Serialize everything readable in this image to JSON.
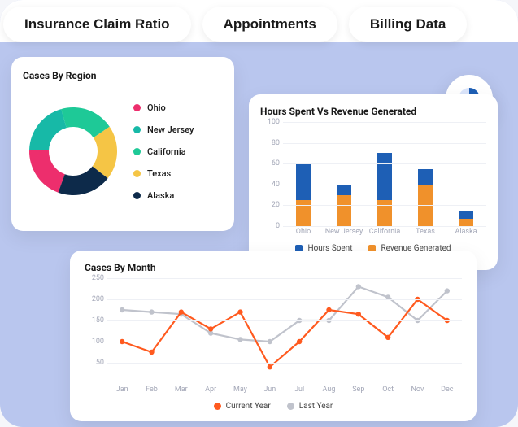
{
  "tabs": {
    "insurance": "Insurance Claim Ratio",
    "appointments": "Appointments",
    "billing": "Billing Data"
  },
  "region": {
    "title": "Cases By Region",
    "legend": {
      "ohio": "Ohio",
      "new_jersey": "New Jersey",
      "california": "California",
      "texas": "Texas",
      "alaska": "Alaska"
    }
  },
  "bar": {
    "title": "Hours Spent Vs Revenue Generated",
    "legend": {
      "hours": "Hours Spent",
      "revenue": "Revenue Generated"
    }
  },
  "line": {
    "title": "Cases By Month",
    "legend": {
      "current": "Current Year",
      "last": "Last Year"
    }
  },
  "colors": {
    "pink": "#ed2e6d",
    "teal": "#17b9a7",
    "green": "#1ec997",
    "yellow": "#f5c545",
    "navy": "#0d2a4a",
    "blue": "#1e5fb5",
    "orange": "#f0912b",
    "orange_line": "#ff5a1f",
    "grey_line": "#c0c3cc"
  },
  "chart_data": [
    {
      "id": "cases_by_region",
      "type": "pie",
      "title": "Cases By Region",
      "categories": [
        "Ohio",
        "New Jersey",
        "California",
        "Texas",
        "Alaska"
      ],
      "values": [
        20,
        20,
        20,
        20,
        20
      ],
      "colors": [
        "#ed2e6d",
        "#17b9a7",
        "#1ec997",
        "#f5c545",
        "#0d2a4a"
      ]
    },
    {
      "id": "hours_vs_revenue",
      "type": "bar",
      "title": "Hours Spent Vs Revenue Generated",
      "categories": [
        "Ohio",
        "New Jersey",
        "California",
        "Texas",
        "Alaska"
      ],
      "series": [
        {
          "name": "Hours Spent",
          "values": [
            35,
            10,
            45,
            15,
            8
          ],
          "color": "#1e5fb5"
        },
        {
          "name": "Revenue Generated",
          "values": [
            25,
            30,
            25,
            40,
            7
          ],
          "color": "#f0912b"
        }
      ],
      "ylim": [
        0,
        100
      ],
      "yticks": [
        0,
        20,
        40,
        60,
        80,
        100
      ],
      "ylabel": "",
      "xlabel": ""
    },
    {
      "id": "cases_by_month",
      "type": "line",
      "title": "Cases By Month",
      "categories": [
        "Jan",
        "Feb",
        "Mar",
        "Apr",
        "May",
        "Jun",
        "Jul",
        "Aug",
        "Sep",
        "Oct",
        "Nov",
        "Dec"
      ],
      "series": [
        {
          "name": "Current Year",
          "values": [
            100,
            75,
            170,
            130,
            170,
            40,
            100,
            175,
            165,
            110,
            200,
            150
          ],
          "color": "#ff5a1f"
        },
        {
          "name": "Last Year",
          "values": [
            175,
            170,
            165,
            120,
            105,
            100,
            150,
            150,
            230,
            205,
            150,
            220
          ],
          "color": "#c0c3cc"
        }
      ],
      "ylim": [
        0,
        250
      ],
      "yticks": [
        50,
        100,
        150,
        200,
        250
      ],
      "ylabel": "",
      "xlabel": ""
    }
  ]
}
